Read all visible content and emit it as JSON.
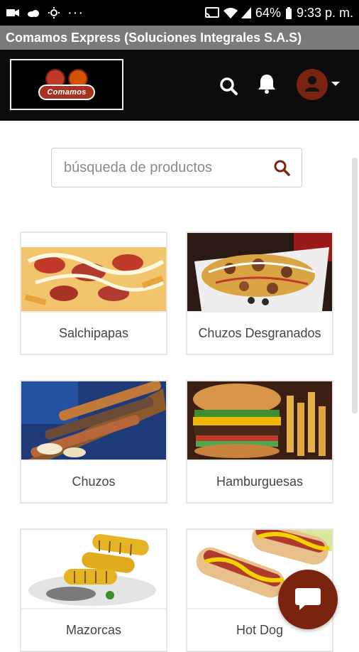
{
  "status_bar": {
    "battery": "64%",
    "time": "9:33 p. m.",
    "dots": "···"
  },
  "app_title": "Comamos Express (Soluciones Integrales S.A.S)",
  "logo": {
    "text": "Comamos"
  },
  "search": {
    "placeholder": "búsqueda de productos"
  },
  "categories": [
    {
      "label": "Salchipapas"
    },
    {
      "label": "Chuzos Desgranados"
    },
    {
      "label": "Chuzos"
    },
    {
      "label": "Hamburguesas"
    },
    {
      "label": "Mazorcas"
    },
    {
      "label": "Hot Dog"
    }
  ],
  "colors": {
    "brand": "#7a2410",
    "header_bg": "#0c0c0c",
    "title_bar": "#7a7a7a"
  },
  "icons": {
    "header_search": "search-icon",
    "notifications": "bell-icon",
    "account": "user-icon",
    "chat": "chat-icon"
  }
}
